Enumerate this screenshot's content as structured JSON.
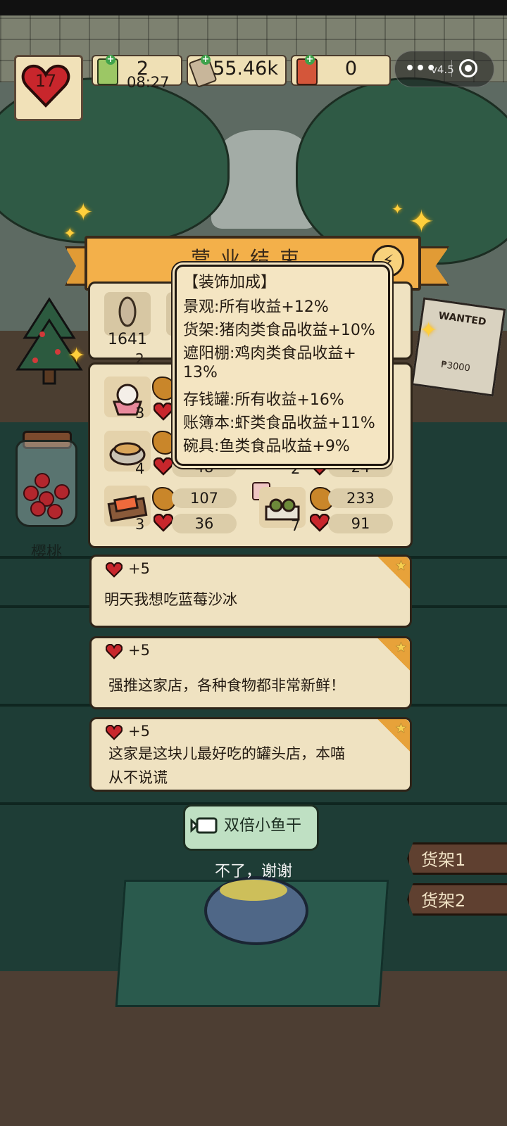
{
  "hud": {
    "hearts": "17",
    "tickets": "2",
    "fish": "55.46k",
    "cans": "0",
    "clock": "08:27"
  },
  "miniprogram_capsule": {
    "menu_dots": "•••",
    "version": "v4.5"
  },
  "banner": {
    "title": "营业结束",
    "share_icon": "share-icon"
  },
  "stats": {
    "fish_total": "1641"
  },
  "orders": {
    "rows": [
      {
        "qty": "3"
      },
      {
        "qty": "4",
        "hearts": "48",
        "right_qty": "2",
        "right_hearts": "24"
      },
      {
        "qty": "3",
        "coins": "107",
        "hearts": "36",
        "right_qty": "7",
        "right_coins": "233",
        "right_hearts": "91"
      }
    ],
    "partial_top_qty": "2"
  },
  "tooltip": {
    "header": "【装饰加成】",
    "lines": [
      "景观:所有收益+12%",
      "货架:猪肉类食品收益+10%",
      "遮阳棚:鸡肉类食品收益+",
      "13%",
      "存钱罐:所有收益+16%",
      "账簿本:虾类食品收益+11%",
      "碗具:鱼类食品收益+9%"
    ]
  },
  "comments": [
    {
      "gain": "+5",
      "text": "明天我想吃蓝莓沙冰"
    },
    {
      "gain": "+5",
      "text": "强推这家店，各种食物都非常新鲜！"
    },
    {
      "gain": "+5",
      "text_line1": "这家是这块儿最好吃的罐头店，本喵",
      "text_line2": "从不说谎"
    }
  ],
  "buttons": {
    "double_fish": "双倍小鱼干",
    "no_thanks": "不了，谢谢"
  },
  "shelves": {
    "shelf1": "货架1",
    "shelf2": "货架2"
  },
  "scene": {
    "jar_label": "樱桃",
    "wanted_poster": "WANTED",
    "poster_price": "₱3000"
  },
  "colors": {
    "banner": "#f3b04a",
    "panel": "#efe2c1",
    "green_button": "#bfe0c3",
    "heart_red": "#c8262c"
  }
}
